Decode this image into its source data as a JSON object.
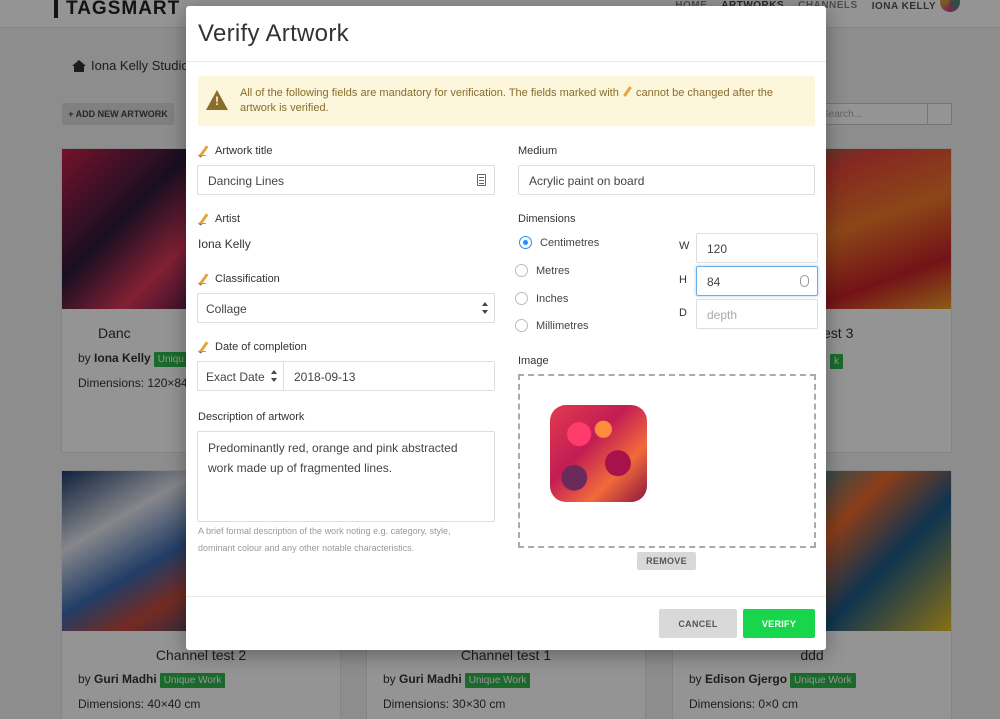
{
  "background": {
    "logo": "TAGSMART",
    "nav": {
      "home": "HOME",
      "artworks": "ARTWORKS",
      "channels": "CHANNELS",
      "user": "IONA KELLY"
    },
    "breadcrumb": "Iona Kelly Studio",
    "add_button": "+ ADD NEW ARTWORK",
    "search_placeholder": "Search...",
    "cards": [
      {
        "title": "Danc",
        "by_prefix": "by",
        "artist": "Iona Kelly",
        "tag": "Uniqu",
        "dimensions": "Dimensions: 120×84"
      },
      {
        "title": "est 3",
        "tag": "k"
      },
      {
        "title": "Channel test 2",
        "by_prefix": "by",
        "artist": "Guri Madhi",
        "tag": "Unique Work",
        "dimensions": "Dimensions: 40×40 cm"
      },
      {
        "title": "Channel test 1",
        "by_prefix": "by",
        "artist": "Guri Madhi",
        "tag": "Unique Work",
        "dimensions": "Dimensions: 30×30 cm"
      },
      {
        "title": "ddd",
        "by_prefix": "by",
        "artist": "Edison Gjergo",
        "tag": "Unique Work",
        "dimensions": "Dimensions: 0×0 cm"
      }
    ]
  },
  "modal": {
    "title": "Verify Artwork",
    "alert": {
      "text_before": "All of the following fields are mandatory for verification. The fields marked with",
      "text_after": "cannot be changed after the artwork is verified.",
      "icon": "warning-icon"
    },
    "artwork_title": {
      "label": "Artwork title",
      "value": "Dancing Lines"
    },
    "artist": {
      "label": "Artist",
      "value": "Iona Kelly"
    },
    "classification": {
      "label": "Classification",
      "value": "Collage"
    },
    "date": {
      "label": "Date of completion",
      "type": "Exact Date",
      "value": "2018-09-13"
    },
    "description": {
      "label": "Description of artwork",
      "value": "Predominantly red, orange and pink abstracted work made up of fragmented lines.",
      "help": "A brief formal description of the work noting e.g. category, style, dominant colour and any other notable characteristics."
    },
    "medium": {
      "label": "Medium",
      "value": "Acrylic paint on board"
    },
    "dimensions": {
      "label": "Dimensions",
      "units": [
        "Centimetres",
        "Metres",
        "Inches",
        "Millimetres"
      ],
      "selected_unit": "Centimetres",
      "w_label": "W",
      "w_value": "120",
      "h_label": "H",
      "h_value": "84",
      "d_label": "D",
      "d_placeholder": "depth"
    },
    "image": {
      "label": "Image",
      "remove": "REMOVE"
    },
    "buttons": {
      "cancel": "CANCEL",
      "verify": "VERIFY"
    },
    "colors": {
      "verify": "#18d64b",
      "alert_bg": "#fcf6dc",
      "alert_text": "#8a6d2a",
      "radio_on": "#1e90ff"
    }
  }
}
